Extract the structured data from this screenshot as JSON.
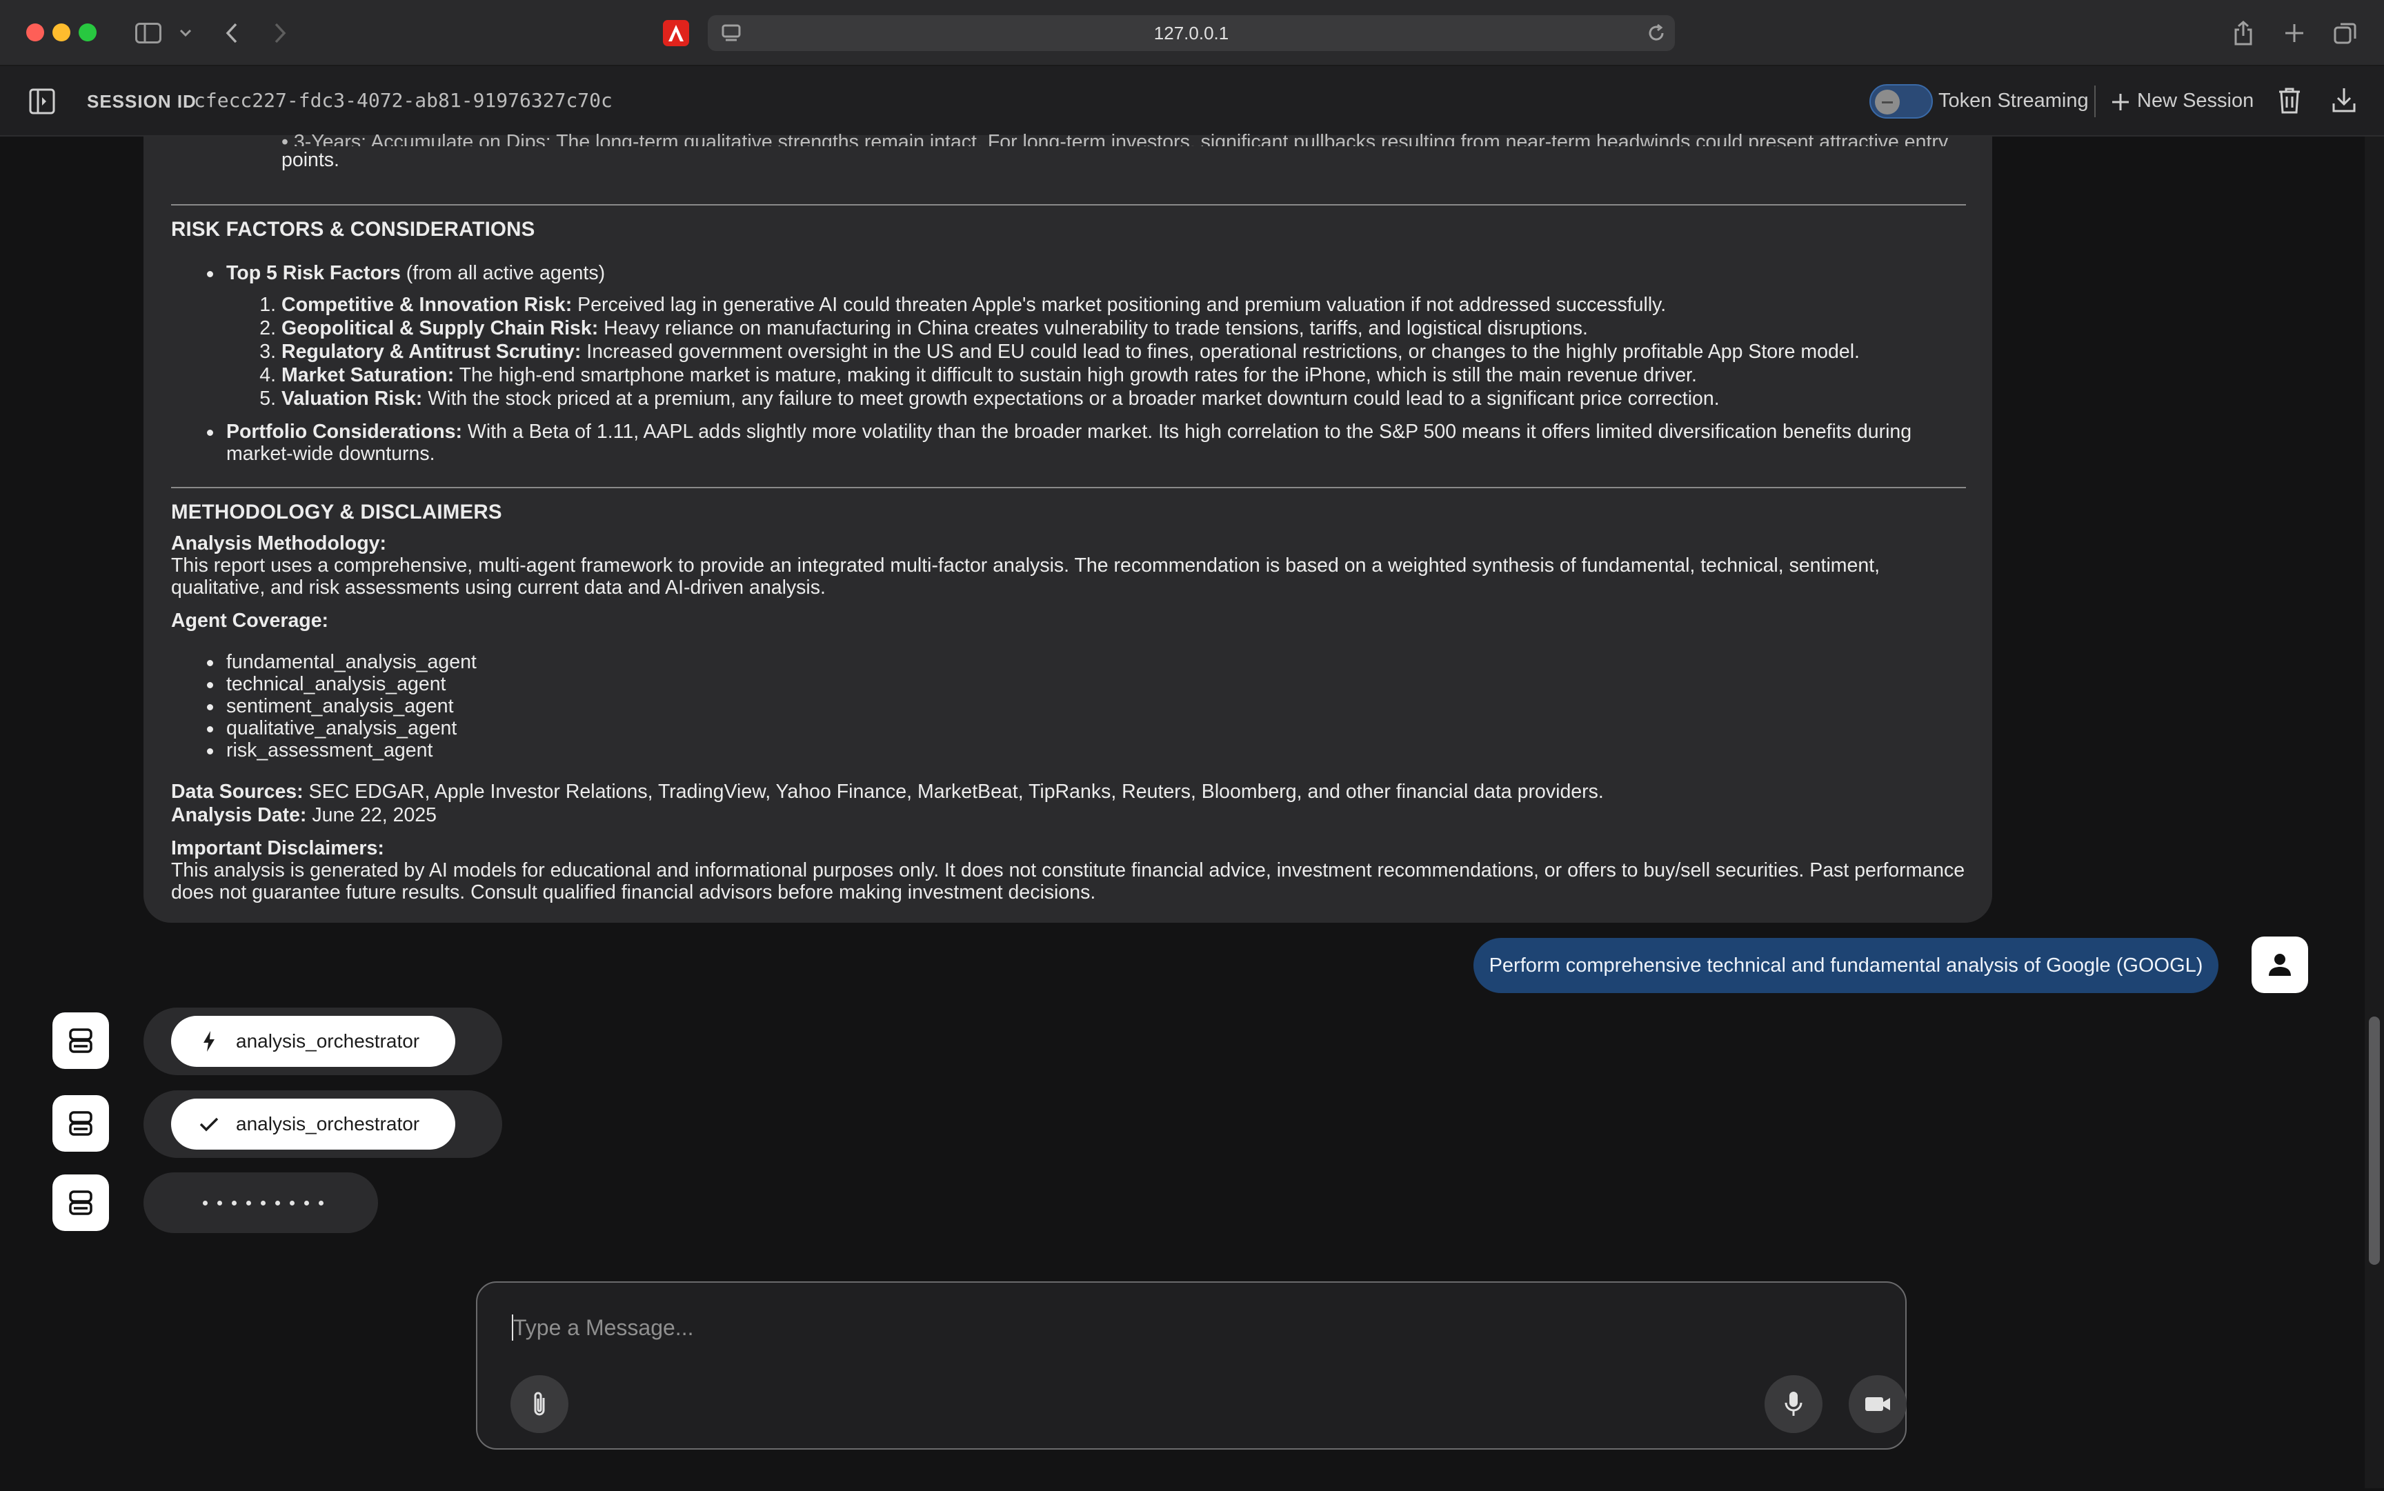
{
  "browser": {
    "url": "127.0.0.1"
  },
  "header": {
    "session_label": "SESSION ID",
    "session_id": "cfecc227-fdc3-4072-ab81-91976327c70c",
    "token_streaming_label": "Token Streaming",
    "new_session_label": "New Session"
  },
  "report": {
    "top_cut_text": "• 3-Years: Accumulate on Dips: The long-term qualitative strengths remain intact. For long-term investors, significant pullbacks resulting from near-term headwinds could present attractive entry",
    "top_cut_text2": "points.",
    "risk_title": "RISK FACTORS & CONSIDERATIONS",
    "top5_bold": "Top 5 Risk Factors",
    "top5_rest": " (from all active agents)",
    "risks": [
      {
        "bold": "Competitive & Innovation Risk:",
        "text": " Perceived lag in generative AI could threaten Apple's market positioning and premium valuation if not addressed successfully."
      },
      {
        "bold": "Geopolitical & Supply Chain Risk:",
        "text": " Heavy reliance on manufacturing in China creates vulnerability to trade tensions, tariffs, and logistical disruptions."
      },
      {
        "bold": "Regulatory & Antitrust Scrutiny:",
        "text": " Increased government oversight in the US and EU could lead to fines, operational restrictions, or changes to the highly profitable App Store model."
      },
      {
        "bold": "Market Saturation:",
        "text": " The high-end smartphone market is mature, making it difficult to sustain high growth rates for the iPhone, which is still the main revenue driver."
      },
      {
        "bold": "Valuation Risk:",
        "text": " With the stock priced at a premium, any failure to meet growth expectations or a broader market downturn could lead to a significant price correction."
      }
    ],
    "portfolio_bold": "Portfolio Considerations:",
    "portfolio_text1": " With a Beta of 1.11, AAPL adds slightly more volatility than the broader market. Its high correlation to the S&P 500 means it offers limited diversification benefits during",
    "portfolio_text2": "market-wide downturns.",
    "method_title": "METHODOLOGY & DISCLAIMERS",
    "analysis_method_label": "Analysis Methodology:",
    "analysis_method_text1": "This report uses a comprehensive, multi-agent framework to provide an integrated multi-factor analysis. The recommendation is based on a weighted synthesis of fundamental, technical, sentiment,",
    "analysis_method_text2": "qualitative, and risk assessments using current data and AI-driven analysis.",
    "agent_coverage_label": "Agent Coverage:",
    "agents": [
      "fundamental_analysis_agent",
      "technical_analysis_agent",
      "sentiment_analysis_agent",
      "qualitative_analysis_agent",
      "risk_assessment_agent"
    ],
    "data_sources_label": "Data Sources:",
    "data_sources_text": " SEC EDGAR, Apple Investor Relations, TradingView, Yahoo Finance, MarketBeat, TipRanks, Reuters, Bloomberg, and other financial data providers.",
    "analysis_date_label": "Analysis Date:",
    "analysis_date_text": " June 22, 2025",
    "disclaimers_label": "Important Disclaimers:",
    "disclaimers_text1": "This analysis is generated by AI models for educational and informational purposes only. It does not constitute financial advice, investment recommendations, or offers to buy/sell securities. Past performance",
    "disclaimers_text2": "does not guarantee future results. Consult qualified financial advisors before making investment decisions."
  },
  "chat": {
    "user_message": "Perform comprehensive technical and fundamental analysis of Google (GOOGL)",
    "agent_calls": [
      {
        "name": "analysis_orchestrator",
        "icon": "bolt-icon"
      },
      {
        "name": "analysis_orchestrator",
        "icon": "check-icon"
      }
    ]
  },
  "input": {
    "placeholder": "Type a Message..."
  },
  "colors": {
    "background": "#131314",
    "card": "#2b2b2d",
    "user_bubble": "#1e4473",
    "accent": "#3a6aa8"
  }
}
